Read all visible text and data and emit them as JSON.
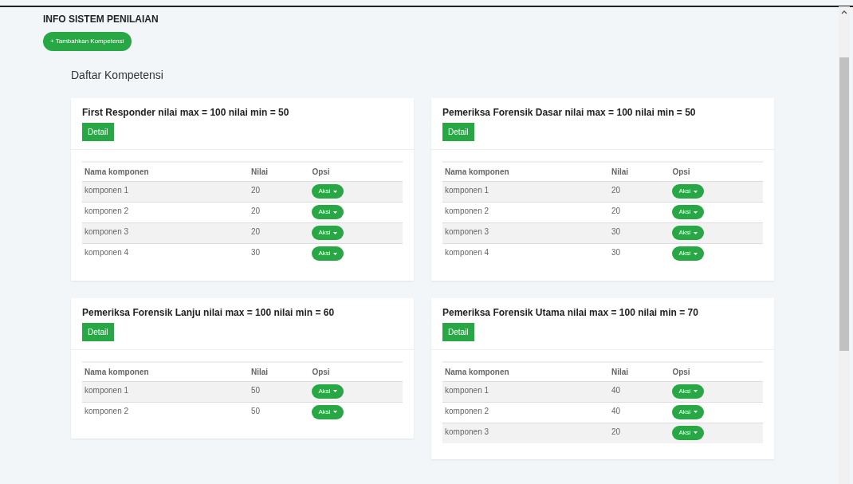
{
  "page_title": "INFO SISTEM PENILAIAN",
  "add_button": "+ Tambahkan Kompetensi",
  "section_title": "Daftar Kompetensi",
  "competencies": [
    {
      "title": "First Responder nilai max = 100 nilai min = 50",
      "detail_button": "Detail",
      "columns": [
        "Nama komponen",
        "Nilai",
        "Opsi"
      ],
      "rows": [
        {
          "name": "komponen 1",
          "value": "20",
          "action": "Aksi"
        },
        {
          "name": "komponen 2",
          "value": "20",
          "action": "Aksi"
        },
        {
          "name": "komponen 3",
          "value": "20",
          "action": "Aksi"
        },
        {
          "name": "komponen 4",
          "value": "30",
          "action": "Aksi"
        }
      ]
    },
    {
      "title": "Pemeriksa Forensik Dasar nilai max = 100 nilai min = 50",
      "detail_button": "Detail",
      "columns": [
        "Nama komponen",
        "Nilai",
        "Opsi"
      ],
      "rows": [
        {
          "name": "komponen 1",
          "value": "20",
          "action": "Aksi"
        },
        {
          "name": "komponen 2",
          "value": "20",
          "action": "Aksi"
        },
        {
          "name": "komponen 3",
          "value": "30",
          "action": "Aksi"
        },
        {
          "name": "komponen 4",
          "value": "30",
          "action": "Aksi"
        }
      ]
    },
    {
      "title": "Pemeriksa Forensik Lanju nilai max = 100 nilai min = 60",
      "detail_button": "Detail",
      "columns": [
        "Nama komponen",
        "Nilai",
        "Opsi"
      ],
      "rows": [
        {
          "name": "komponen 1",
          "value": "50",
          "action": "Aksi"
        },
        {
          "name": "komponen 2",
          "value": "50",
          "action": "Aksi"
        }
      ]
    },
    {
      "title": "Pemeriksa Forensik Utama nilai max = 100 nilai min = 70",
      "detail_button": "Detail",
      "columns": [
        "Nama komponen",
        "Nilai",
        "Opsi"
      ],
      "rows": [
        {
          "name": "komponen 1",
          "value": "40",
          "action": "Aksi"
        },
        {
          "name": "komponen 2",
          "value": "40",
          "action": "Aksi"
        },
        {
          "name": "komponen 3",
          "value": "20",
          "action": "Aksi"
        }
      ]
    }
  ]
}
